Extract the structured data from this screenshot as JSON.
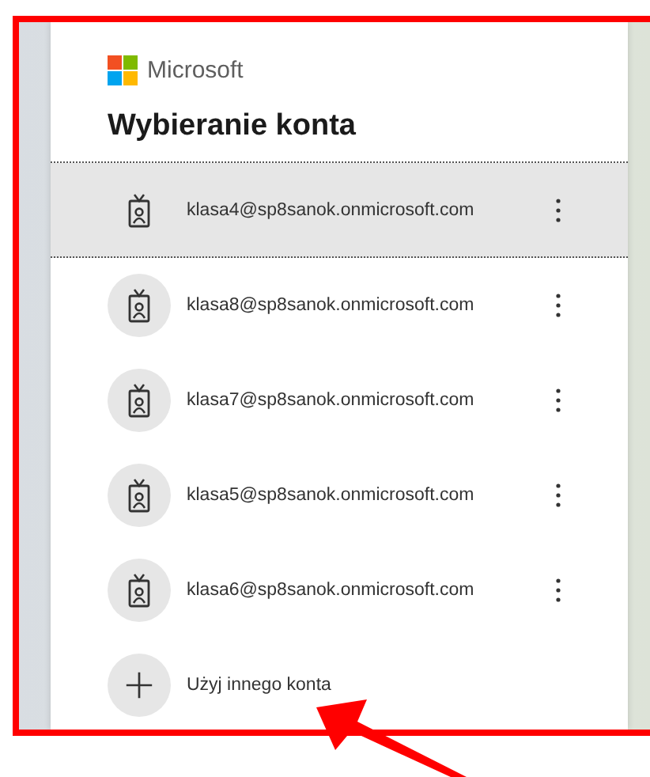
{
  "brand": "Microsoft",
  "title": "Wybieranie konta",
  "accounts": [
    {
      "email": "klasa4@sp8sanok.onmicrosoft.com",
      "selected": true
    },
    {
      "email": "klasa8@sp8sanok.onmicrosoft.com",
      "selected": false
    },
    {
      "email": "klasa7@sp8sanok.onmicrosoft.com",
      "selected": false
    },
    {
      "email": "klasa5@sp8sanok.onmicrosoft.com",
      "selected": false
    },
    {
      "email": "klasa6@sp8sanok.onmicrosoft.com",
      "selected": false
    }
  ],
  "other_account": "Użyj innego konta"
}
